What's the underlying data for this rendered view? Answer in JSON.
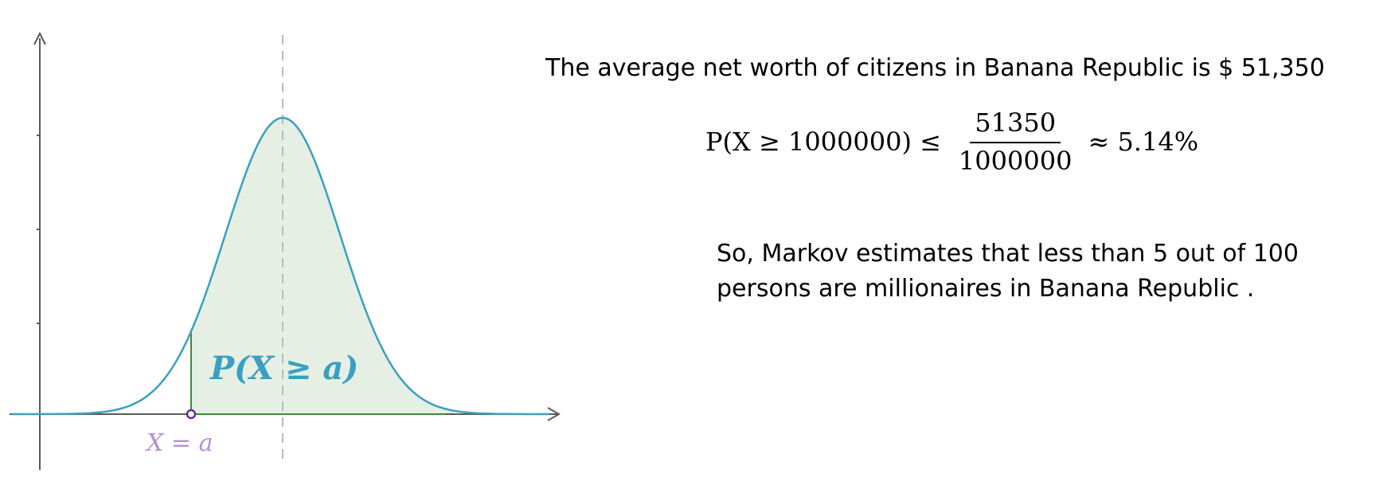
{
  "diagram": {
    "title": "",
    "curve_color": "#3a9fc0",
    "shade_color": "#e6efe4",
    "axis_color": "#5a5a5a",
    "mean_line_color": "#b8b8c8",
    "marker_color": "#6b2c91",
    "x_label_color": "#b58fd6",
    "region_label": "P(X ≥ a)",
    "x_point_label": "X = a"
  },
  "text": {
    "headline": "The average net worth of citizens in Banana Republic is $ 51,350",
    "formula_lhs": "P(X ≥ 1000000) ≤",
    "formula_numerator": "51350",
    "formula_denominator": "1000000",
    "formula_rhs": "≈ 5.14%",
    "conclusion_line1": "So, Markov estimates that less than 5 out of 100",
    "conclusion_line2": "persons are millionaires in Banana Republic ."
  }
}
